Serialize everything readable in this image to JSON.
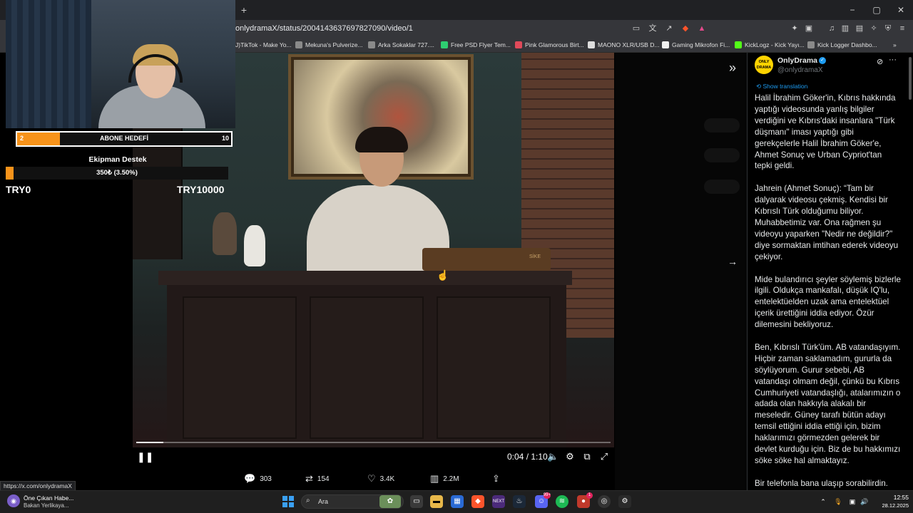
{
  "browser": {
    "new_tab": "+",
    "url": "onlydramaX/status/2004143637697827090/video/1",
    "window_controls": [
      "−",
      "▢",
      "✕"
    ],
    "bookmarks": [
      "J)TikTok - Make Yo...",
      "Mekuna's Pulverize...",
      "Arka Sokaklar 727....",
      "Free PSD Flyer Tem...",
      "Pink Glamorous Birt...",
      "MAONO XLR/USB D...",
      "Gaming Mikrofon Fi...",
      "KickLogz - Kick Yayı...",
      "Kick Logger Dashbo..."
    ],
    "bookmarks_more": "»"
  },
  "video": {
    "current_time": "0:04",
    "duration": "1:10",
    "time_display": "0:04 / 1:10",
    "progress_fraction": 0.057,
    "book_label": "SİKE"
  },
  "engagement": {
    "replies": "303",
    "reposts": "154",
    "likes": "3.4K",
    "views": "2.2M"
  },
  "tweet": {
    "author_name": "OnlyDrama",
    "author_handle": "@onlydramaX",
    "avatar_text": "ONLY DRAMA",
    "translate_label": "Show translation",
    "text": "Halil İbrahim Göker'in, Kıbrıs hakkında yaptığı videosunda yanlış bilgiler verdiğini ve Kıbrıs'daki insanlara \"Türk düşmanı\" iması yaptığı gibi gerekçelerle Halil İbrahim Göker'e, Ahmet Sonuç ve Urban Cypriot'tan tepki geldi.\n\nJahrein (Ahmet Sonuç): “Tam bir dalyarak videosu çekmiş. Kendisi bir Kıbrıslı Türk olduğumu biliyor. Muhabbetimiz var. Ona rağmen şu videoyu yaparken \"Nedir ne değildir?\" diye sormaktan imtihan ederek videoyu çekiyor.\n\nMide bulandırıcı şeyler söylemiş bizlerle ilgili. Oldukça mankafalı, düşük IQ'lu, entelektüelden uzak ama entelektüel içerik ürettiğini iddia ediyor. Özür dilemesini bekliyoruz.\n\nBen, Kıbrıslı Türk'üm. AB vatandaşıyım. Hiçbir zaman saklamadım, gururla da söylüyorum. Gurur sebebi, AB vatandaşı olmam değil, çünkü bu Kıbrıs Cumhuriyeti vatandaşlığı, atalarımızın o adada olan hakkıyla alakalı bir meseledir. Güney tarafı bütün adayı temsil ettiğini iddia ettiği için, bizim haklarımızı görmezden gelerek bir devlet kurduğu için. Biz de bu hakkımızı söke söke hal almaktayız.\n\nBir telefonla bana ulaşıp sorabilirdin."
  },
  "overlay": {
    "sub_goal_current": "2",
    "sub_goal_label": "ABONE HEDEFİ",
    "sub_goal_target": "10",
    "sub_goal_fraction": 0.2,
    "equipment_title": "Ekipman Destek",
    "equipment_label": "350₺ (3.50%)",
    "equipment_fraction": 0.035,
    "equipment_min": "TRY0",
    "equipment_max": "TRY10000"
  },
  "status_url": "https://x.com/onlydramaX",
  "taskbar": {
    "news_title": "Öne Çıkan Habe...",
    "news_subtitle": "Bakan Yerlikaya...",
    "search_placeholder": "Ara",
    "time": "12:55",
    "date": "28.12.2025",
    "discord_badge": "99+",
    "notif_badge": "1"
  },
  "colors": {
    "accent_orange": "#f7931a",
    "x_blue": "#1d9bf0",
    "background": "#000000"
  }
}
